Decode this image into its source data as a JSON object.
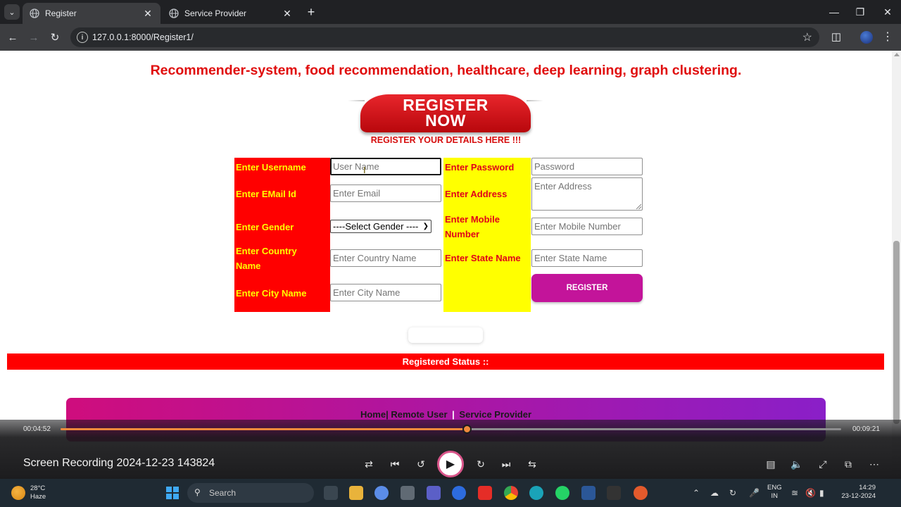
{
  "browser": {
    "tabs": [
      {
        "title": "Register",
        "active": true
      },
      {
        "title": "Service Provider",
        "active": false
      }
    ],
    "url": "127.0.0.1:8000/Register1/"
  },
  "page": {
    "headline": "Recommender-system, food recommendation, healthcare, deep learning, graph clustering.",
    "banner": {
      "line1": "REGISTER",
      "line2": "NOW"
    },
    "subheading": "REGISTER YOUR DETAILS HERE !!!",
    "form": {
      "labels": {
        "username": "Enter Username",
        "email": "Enter EMail Id",
        "gender": "Enter Gender",
        "country": "Enter Country Name",
        "city": "Enter City Name",
        "password": "Enter Password",
        "address": "Enter Address",
        "mobile": "Enter Mobile Number",
        "state": "Enter State Name"
      },
      "placeholders": {
        "username": "User Name",
        "email": "Enter Email",
        "country": "Enter Country Name",
        "city": "Enter City Name",
        "password": "Password",
        "address": "Enter Address",
        "mobile": "Enter Mobile Number",
        "state": "Enter State Name"
      },
      "gender_selected": "----Select Gender ----",
      "submit_label": "REGISTER"
    },
    "status_label": "Registered Status ::",
    "footer_links": {
      "home": "Home",
      "remote_user": "Remote User",
      "service_provider": "Service Provider"
    },
    "colors": {
      "label_red": "#ff0000",
      "label_yellow": "#ffff00",
      "button": "#c3149a",
      "footer_start": "#cf0d7d",
      "footer_end": "#8a1fc8"
    }
  },
  "player": {
    "elapsed": "00:04:52",
    "total": "00:09:21",
    "progress": 0.52,
    "title": "Screen Recording 2024-12-23 143824"
  },
  "taskbar": {
    "weather_temp": "28°C",
    "weather_desc": "Haze",
    "search_placeholder": "Search",
    "lang_line1": "ENG",
    "lang_line2": "IN",
    "time": "14:29",
    "date": "23-12-2024"
  }
}
